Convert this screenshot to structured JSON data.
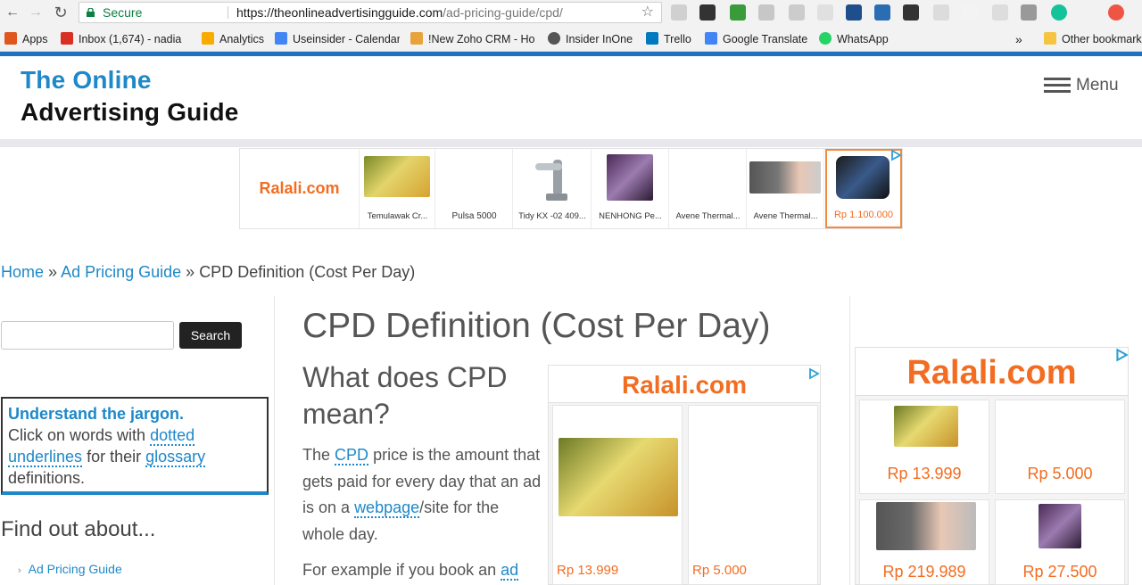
{
  "browser": {
    "secure_label": "Secure",
    "url_host": "https://theonlineadvertisingguide.com",
    "url_path": "/ad-pricing-guide/cpd/",
    "bookmarks": [
      {
        "label": "Apps",
        "icon": "apps-grid-icon",
        "color": "#e0561f"
      },
      {
        "label": "Inbox (1,674) - nadia",
        "icon": "gmail-icon",
        "color": "#d93025"
      },
      {
        "label": "Analytics",
        "icon": "analytics-icon",
        "color": "#f9ab00"
      },
      {
        "label": "Useinsider - Calendar",
        "icon": "calendar-icon",
        "color": "#4285f4"
      },
      {
        "label": "!New Zoho CRM - Ho",
        "icon": "zoho-icon",
        "color": "#e8a33d"
      },
      {
        "label": "Insider InOne",
        "icon": "insider-icon",
        "color": "#555555"
      },
      {
        "label": "Trello",
        "icon": "trello-icon",
        "color": "#0079bf"
      },
      {
        "label": "Google Translate",
        "icon": "translate-icon",
        "color": "#4285f4"
      },
      {
        "label": "WhatsApp",
        "icon": "whatsapp-icon",
        "color": "#25d366"
      }
    ],
    "overflow": "»",
    "other_bookmarks": "Other bookmarks"
  },
  "site": {
    "logo_line1": "The Online",
    "logo_line2": "Advertising Guide",
    "menu_label": "Menu",
    "brand_color": "#1e88c8"
  },
  "top_ad": {
    "brand": "Ralali.com",
    "items": [
      {
        "caption": "Temulawak Cr..."
      },
      {
        "caption": "Pulsa 5000"
      },
      {
        "caption": "Tidy KX -02 409..."
      },
      {
        "caption": "NENHONG Pe..."
      },
      {
        "caption": "Avene Thermal..."
      },
      {
        "caption": "Avene Thermal..."
      },
      {
        "caption": "Rp 1.100.000"
      }
    ]
  },
  "breadcrumb": {
    "home": "Home",
    "sep": "»",
    "guide": "Ad Pricing Guide",
    "current": "CPD Definition (Cost Per Day)"
  },
  "sidebar": {
    "search_button": "Search",
    "jargon_title": "Understand the jargon.",
    "jargon_t1": "Click on words with",
    "jargon_dotted": "dotted",
    "jargon_underlines": "underlines",
    "jargon_t2": "for their",
    "jargon_glossary": "glossary",
    "jargon_t3": "definitions.",
    "find_out": "Find out about...",
    "links": [
      "Ad Pricing Guide"
    ]
  },
  "article": {
    "title": "CPD Definition (Cost Per Day)",
    "subtitle": "What does CPD mean?",
    "p1_a": "The",
    "p1_cpd": "CPD",
    "p1_b": "price is the amount that gets paid for every day that an ad is on a",
    "p1_webpage": "webpage",
    "p1_c": "/site for the whole day.",
    "p2_a": "For example if you book an",
    "p2_ad": "ad"
  },
  "mid_ad": {
    "brand": "Ralali.com",
    "prices": [
      "Rp 13.999",
      "Rp 5.000"
    ]
  },
  "right_ad": {
    "brand": "Ralali.com",
    "prices": [
      "Rp 13.999",
      "Rp 5.000",
      "Rp 219.989",
      "Rp 27.500"
    ]
  }
}
